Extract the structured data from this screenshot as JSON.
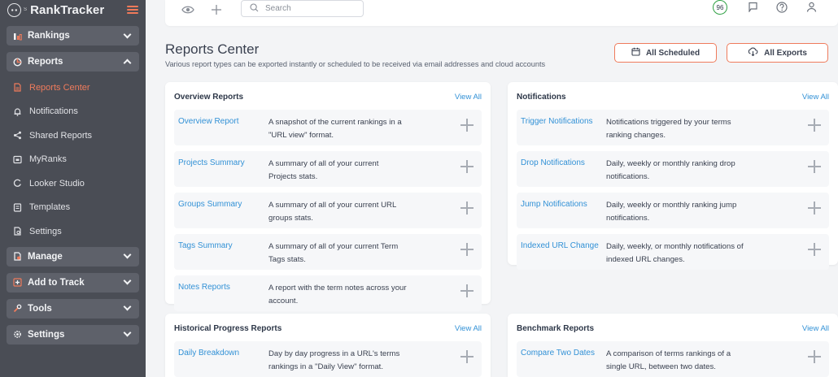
{
  "app": {
    "logo_text": "RankTracker",
    "logo_badge": "S"
  },
  "sidebar": {
    "groups": [
      {
        "label": "Rankings"
      },
      {
        "label": "Reports"
      },
      {
        "label": "Manage"
      },
      {
        "label": "Add to Track"
      },
      {
        "label": "Tools"
      },
      {
        "label": "Settings"
      }
    ],
    "report_items": [
      {
        "label": "Reports Center"
      },
      {
        "label": "Notifications"
      },
      {
        "label": "Shared Reports"
      },
      {
        "label": "MyRanks"
      },
      {
        "label": "Looker Studio"
      },
      {
        "label": "Templates"
      },
      {
        "label": "Settings"
      }
    ]
  },
  "topbar": {
    "search_placeholder": "Search",
    "score": "96"
  },
  "header": {
    "title": "Reports Center",
    "description": "Various report types can be exported instantly or scheduled to be received via email addresses and cloud accounts",
    "btn_scheduled": "All Scheduled",
    "btn_exports": "All Exports"
  },
  "cards": {
    "overview": {
      "title": "Overview Reports",
      "view_all": "View All",
      "rows": [
        {
          "name": "Overview Report",
          "desc1": "A snapshot of the current rankings in a",
          "desc2": "\"URL view\" format."
        },
        {
          "name": "Projects Summary",
          "desc1": "A summary of all of your current",
          "desc2": "Projects stats."
        },
        {
          "name": "Groups Summary",
          "desc1": "A summary of all of your current URL",
          "desc2": "groups stats."
        },
        {
          "name": "Tags Summary",
          "desc1": "A summary of all of your current Term",
          "desc2": "Tags stats."
        },
        {
          "name": "Notes Reports",
          "desc1": "A report with the term notes across your",
          "desc2": "account."
        }
      ]
    },
    "notifications": {
      "title": "Notifications",
      "view_all": "View All",
      "rows": [
        {
          "name": "Trigger Notifications",
          "desc1": "Notifications triggered by your terms",
          "desc2": "ranking changes."
        },
        {
          "name": "Drop Notifications",
          "desc1": "Daily, weekly or monthly ranking drop",
          "desc2": "notifications."
        },
        {
          "name": "Jump Notifications",
          "desc1": "Daily, weekly or monthly ranking jump",
          "desc2": "notifications."
        },
        {
          "name": "Indexed URL Change",
          "desc1": "Daily, weekly, or monthly notifications of",
          "desc2": "indexed URL changes."
        }
      ]
    },
    "historical": {
      "title": "Historical Progress Reports",
      "view_all": "View All",
      "rows": [
        {
          "name": "Daily Breakdown",
          "desc1": "Day by day progress in a URL's terms",
          "desc2": "rankings in a \"Daily View\" format."
        }
      ]
    },
    "benchmark": {
      "title": "Benchmark Reports",
      "view_all": "View All",
      "rows": [
        {
          "name": "Compare Two Dates",
          "desc1": "A comparison of terms rankings of a",
          "desc2": "single URL, between two dates."
        }
      ]
    }
  },
  "colors": {
    "accent": "#ef7b5c",
    "link": "#3291d6",
    "sidebar": "#4a4d55",
    "score_ring": "#2ea043"
  }
}
